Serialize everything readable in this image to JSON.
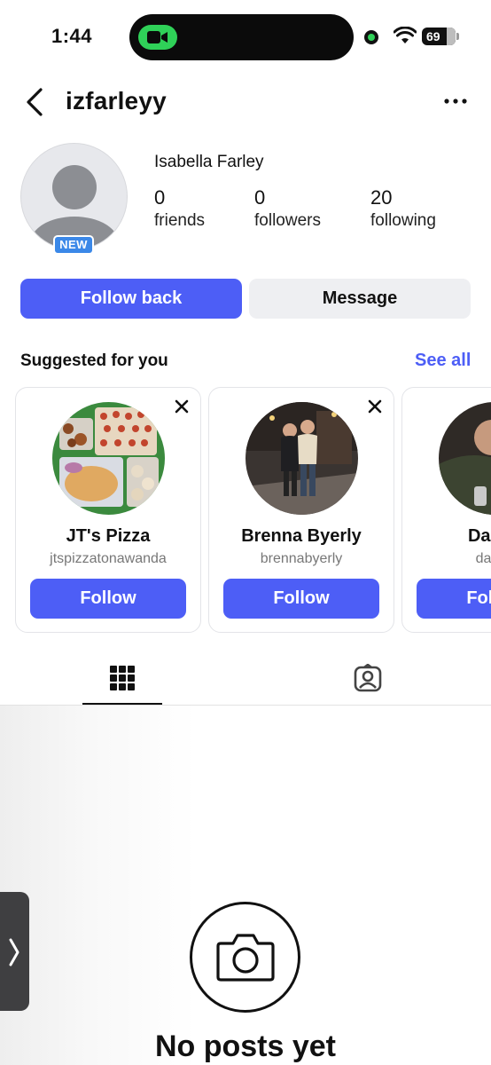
{
  "status_bar": {
    "time": "1:44",
    "battery": "69"
  },
  "header": {
    "username": "izfarleyy"
  },
  "profile": {
    "full_name": "Isabella Farley",
    "badge": "NEW",
    "stats": [
      {
        "value": "0",
        "label": "friends"
      },
      {
        "value": "0",
        "label": "followers"
      },
      {
        "value": "20",
        "label": "following"
      }
    ]
  },
  "actions": {
    "follow_back": "Follow back",
    "message": "Message"
  },
  "suggested": {
    "title": "Suggested for you",
    "see_all": "See all",
    "cards": [
      {
        "name": "JT's Pizza",
        "handle": "jtspizzatonawanda",
        "button": "Follow"
      },
      {
        "name": "Brenna Byerly",
        "handle": "brennabyerly",
        "button": "Follow"
      },
      {
        "name": "Daniel",
        "handle": "daniel",
        "button": "Follow"
      }
    ]
  },
  "tabs": [
    {
      "icon": "grid-icon",
      "active": true
    },
    {
      "icon": "tagged-person-icon",
      "active": false
    }
  ],
  "empty_state": {
    "text": "No posts yet",
    "icon": "camera-icon"
  },
  "colors": {
    "accent": "#4d5ef6",
    "badge": "#3b88e8",
    "dynamic_island_camera": "#2fd158"
  }
}
